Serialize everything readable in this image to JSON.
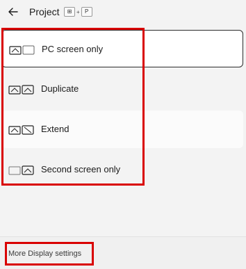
{
  "header": {
    "title": "Project",
    "shortcut": {
      "win_key": "⊞",
      "plus": "+",
      "key": "P"
    }
  },
  "options": [
    {
      "label": "PC screen only",
      "icon": "pc-screen-only-icon",
      "selected": true
    },
    {
      "label": "Duplicate",
      "icon": "duplicate-icon",
      "selected": false
    },
    {
      "label": "Extend",
      "icon": "extend-icon",
      "selected": false
    },
    {
      "label": "Second screen only",
      "icon": "second-screen-only-icon",
      "selected": false
    }
  ],
  "footer": {
    "link_label": "More Display settings"
  },
  "colors": {
    "background": "#f3f3f3",
    "highlight": "#d90000",
    "selected_border": "#2b2b2b"
  }
}
